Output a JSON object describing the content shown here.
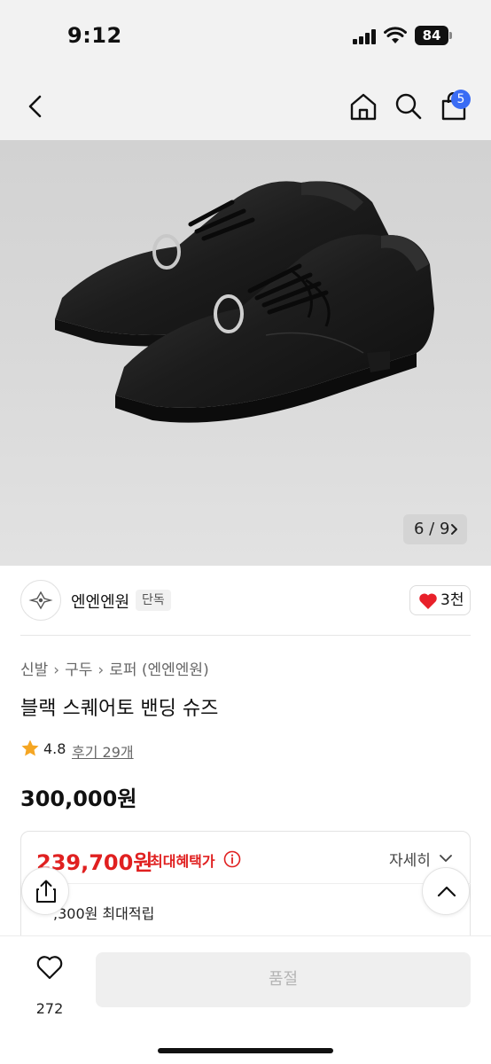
{
  "status_bar": {
    "time": "9:12",
    "battery": "84"
  },
  "header": {
    "cart_count": "5"
  },
  "gallery": {
    "counter": "6 / 9"
  },
  "brand": {
    "name": "엔엔엔원",
    "badge": "단독",
    "likes": "3천"
  },
  "breadcrumb": [
    "신발",
    "구두",
    "로퍼 (엔엔엔원)"
  ],
  "product": {
    "title": "블랙 스퀘어토 밴딩 슈즈",
    "rating": "4.8",
    "reviews": "후기 29개",
    "price": "300,000원"
  },
  "benefit": {
    "price": "239,700원",
    "label": "최대혜택가",
    "detail_label": "자세히",
    "points": ",300원 최대적립"
  },
  "bottom_bar": {
    "wish_count": "272",
    "buy_label": "품절"
  },
  "colors": {
    "accent_red": "#e02020",
    "badge_blue": "#3a6cf4",
    "heart_red": "#e8202a"
  }
}
